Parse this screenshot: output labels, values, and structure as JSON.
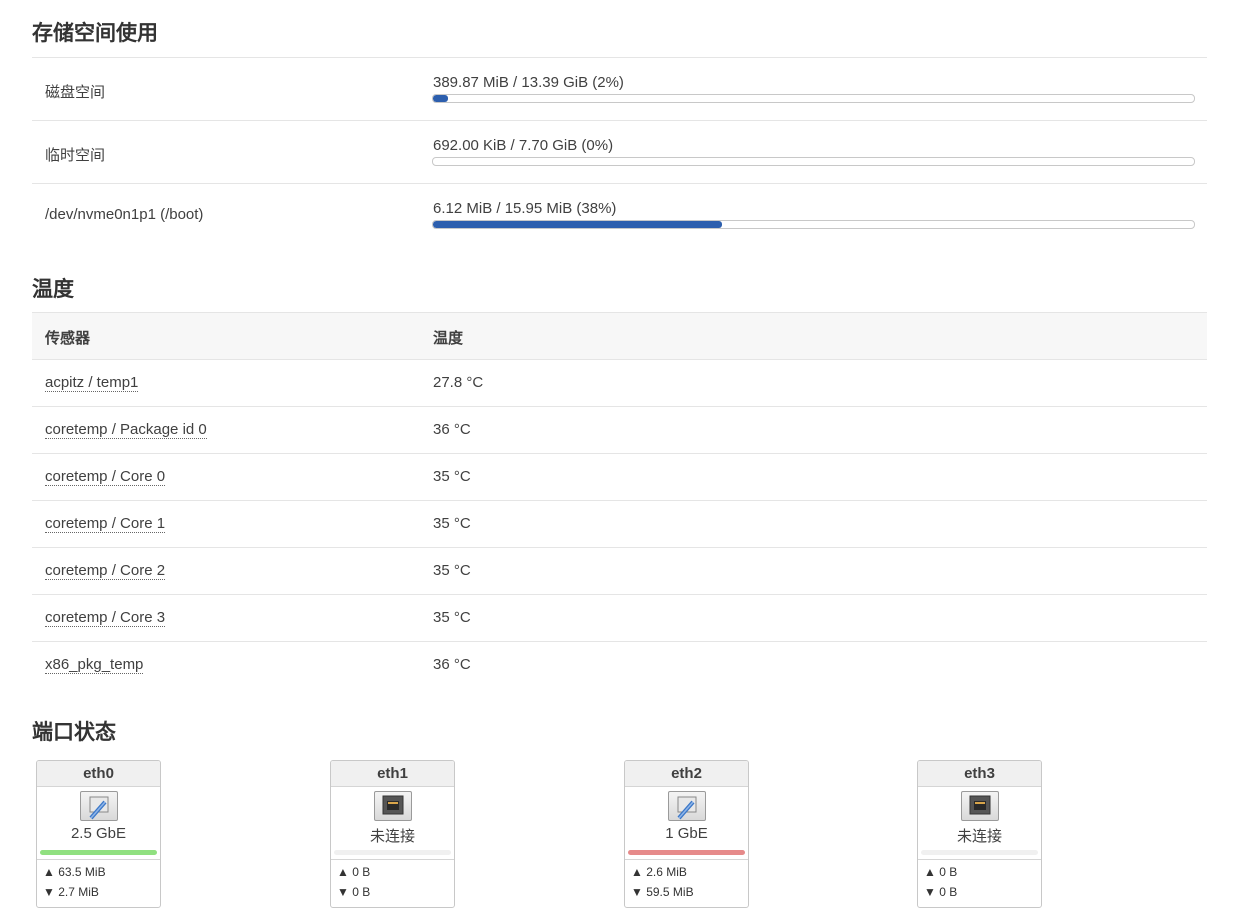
{
  "storage": {
    "title": "存储空间使用",
    "rows": [
      {
        "label": "磁盘空间",
        "value": "389.87 MiB / 13.39 GiB (2%)",
        "percent": 2
      },
      {
        "label": "临时空间",
        "value": "692.00 KiB / 7.70 GiB (0%)",
        "percent": 0
      },
      {
        "label": "/dev/nvme0n1p1 (/boot)",
        "value": "6.12 MiB / 15.95 MiB (38%)",
        "percent": 38
      }
    ]
  },
  "temperature": {
    "title": "温度",
    "col_sensor": "传感器",
    "col_temp": "温度",
    "rows": [
      {
        "sensor": "acpitz / temp1",
        "temp": "27.8 °C"
      },
      {
        "sensor": "coretemp / Package id 0",
        "temp": "36 °C"
      },
      {
        "sensor": "coretemp / Core 0",
        "temp": "35 °C"
      },
      {
        "sensor": "coretemp / Core 1",
        "temp": "35 °C"
      },
      {
        "sensor": "coretemp / Core 2",
        "temp": "35 °C"
      },
      {
        "sensor": "coretemp / Core 3",
        "temp": "35 °C"
      },
      {
        "sensor": "x86_pkg_temp",
        "temp": "36 °C"
      }
    ]
  },
  "ports": {
    "title": "端口状态",
    "items": [
      {
        "name": "eth0",
        "status": "2.5 GbE",
        "connected": true,
        "indicator_color": "#90e080",
        "tx": "▲ 63.5 MiB",
        "rx": "▼ 2.7 MiB"
      },
      {
        "name": "eth1",
        "status": "未连接",
        "connected": false,
        "indicator_color": "#f0f0f0",
        "tx": "▲ 0 B",
        "rx": "▼ 0 B"
      },
      {
        "name": "eth2",
        "status": "1 GbE",
        "connected": true,
        "indicator_color": "#e68a8a",
        "tx": "▲ 2.6 MiB",
        "rx": "▼ 59.5 MiB"
      },
      {
        "name": "eth3",
        "status": "未连接",
        "connected": false,
        "indicator_color": "#f0f0f0",
        "tx": "▲ 0 B",
        "rx": "▼ 0 B"
      }
    ]
  },
  "colors": {
    "bar_fill": "#2d5fae"
  }
}
